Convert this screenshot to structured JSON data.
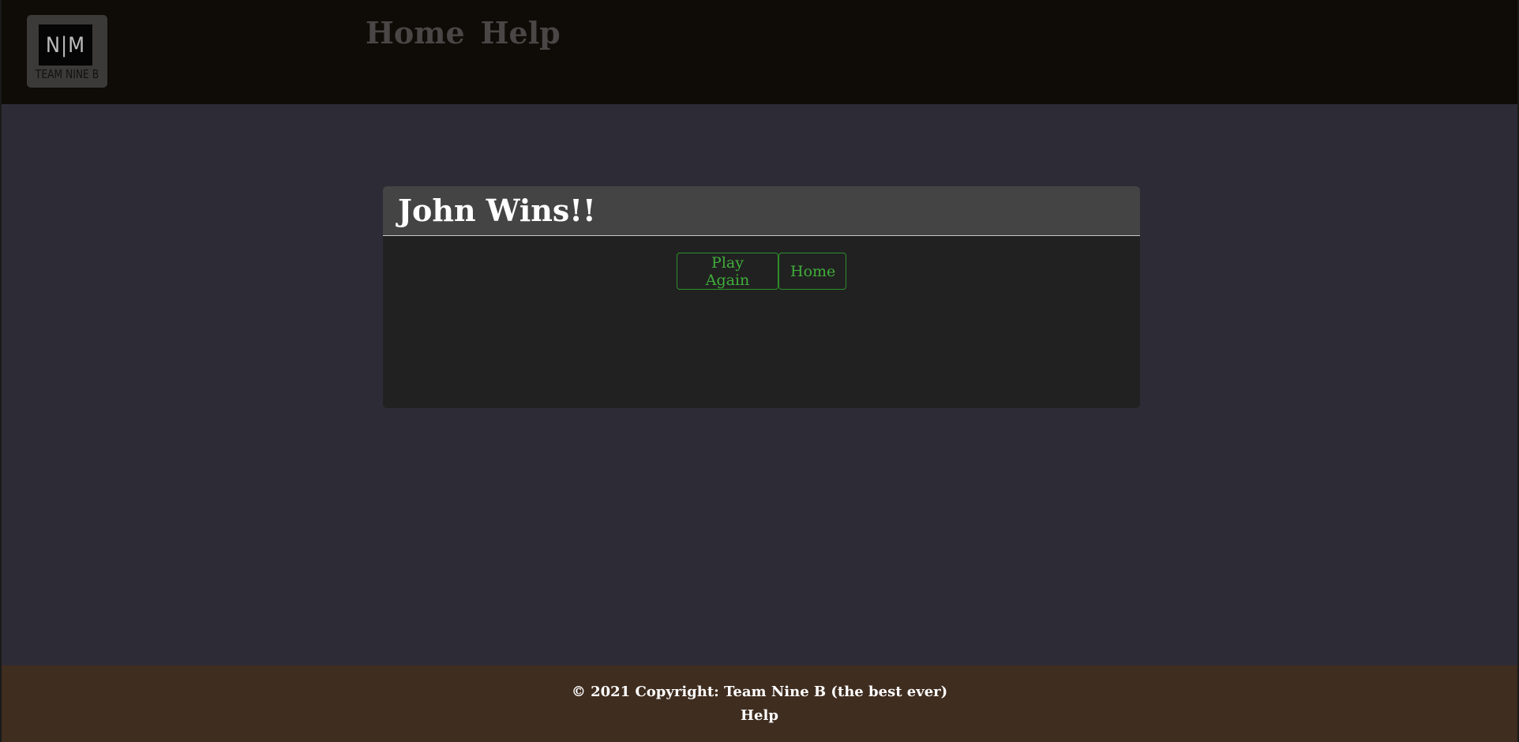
{
  "navbar": {
    "logo_mark": "N|M",
    "logo_caption": "TEAM NINE B",
    "links": [
      {
        "label": "Home"
      },
      {
        "label": "Help"
      }
    ]
  },
  "result_card": {
    "title": "John Wins!!",
    "buttons": {
      "play_again": "Play Again",
      "home": "Home"
    }
  },
  "footer": {
    "copyright": "© 2021 Copyright: Team Nine B (the best ever)",
    "help_link": "Help"
  },
  "colors": {
    "navbar_bg": "#0f0b06",
    "page_bg": "#2d2b36",
    "card_header_bg": "#444444",
    "card_body_bg": "#212121",
    "button_accent": "#3fae3a",
    "footer_bg": "#3f2d20"
  }
}
